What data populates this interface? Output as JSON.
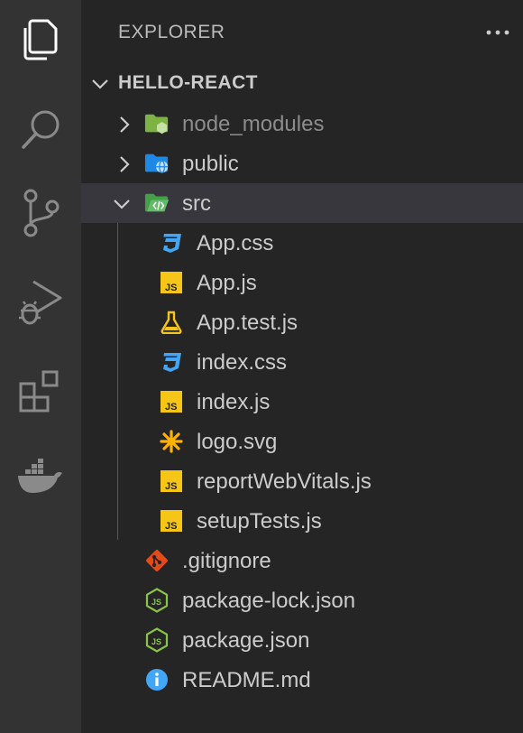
{
  "activity_bar": {
    "items": [
      {
        "name": "explorer",
        "icon": "files-icon",
        "active": true
      },
      {
        "name": "search",
        "icon": "search-icon"
      },
      {
        "name": "source-control",
        "icon": "source-control-icon"
      },
      {
        "name": "run-and-debug",
        "icon": "run-debug-icon"
      },
      {
        "name": "extensions",
        "icon": "extensions-icon"
      },
      {
        "name": "docker",
        "icon": "docker-icon"
      }
    ]
  },
  "explorer": {
    "title": "EXPLORER",
    "more_actions_icon": "ellipsis-icon",
    "section_title": "HELLO-REACT",
    "items": [
      {
        "label": "node_modules",
        "type": "folder",
        "expanded": false,
        "icon": "folder-node-icon",
        "dimmed": true
      },
      {
        "label": "public",
        "type": "folder",
        "expanded": false,
        "icon": "folder-public-icon"
      },
      {
        "label": "src",
        "type": "folder",
        "expanded": true,
        "icon": "folder-src-icon",
        "selected": true
      },
      {
        "label": "App.css",
        "type": "file",
        "icon": "css-icon"
      },
      {
        "label": "App.js",
        "type": "file",
        "icon": "js-icon"
      },
      {
        "label": "App.test.js",
        "type": "file",
        "icon": "test-icon"
      },
      {
        "label": "index.css",
        "type": "file",
        "icon": "css-icon"
      },
      {
        "label": "index.js",
        "type": "file",
        "icon": "js-icon"
      },
      {
        "label": "logo.svg",
        "type": "file",
        "icon": "svg-icon"
      },
      {
        "label": "reportWebVitals.js",
        "type": "file",
        "icon": "js-icon"
      },
      {
        "label": "setupTests.js",
        "type": "file",
        "icon": "js-icon"
      },
      {
        "label": ".gitignore",
        "type": "file",
        "icon": "git-icon"
      },
      {
        "label": "package-lock.json",
        "type": "file",
        "icon": "nodejs-icon"
      },
      {
        "label": "package.json",
        "type": "file",
        "icon": "nodejs-icon"
      },
      {
        "label": "README.md",
        "type": "file",
        "icon": "info-icon"
      }
    ]
  },
  "colors": {
    "activity_bar_bg": "#333333",
    "sidebar_bg": "#252526",
    "selected_row_bg": "#37373d",
    "text": "#cccccc",
    "css_blue": "#42a5f5",
    "js_yellow": "#f5c518",
    "node_green": "#8bc34a",
    "git_red": "#e64a19",
    "info_blue": "#42a5f5"
  }
}
